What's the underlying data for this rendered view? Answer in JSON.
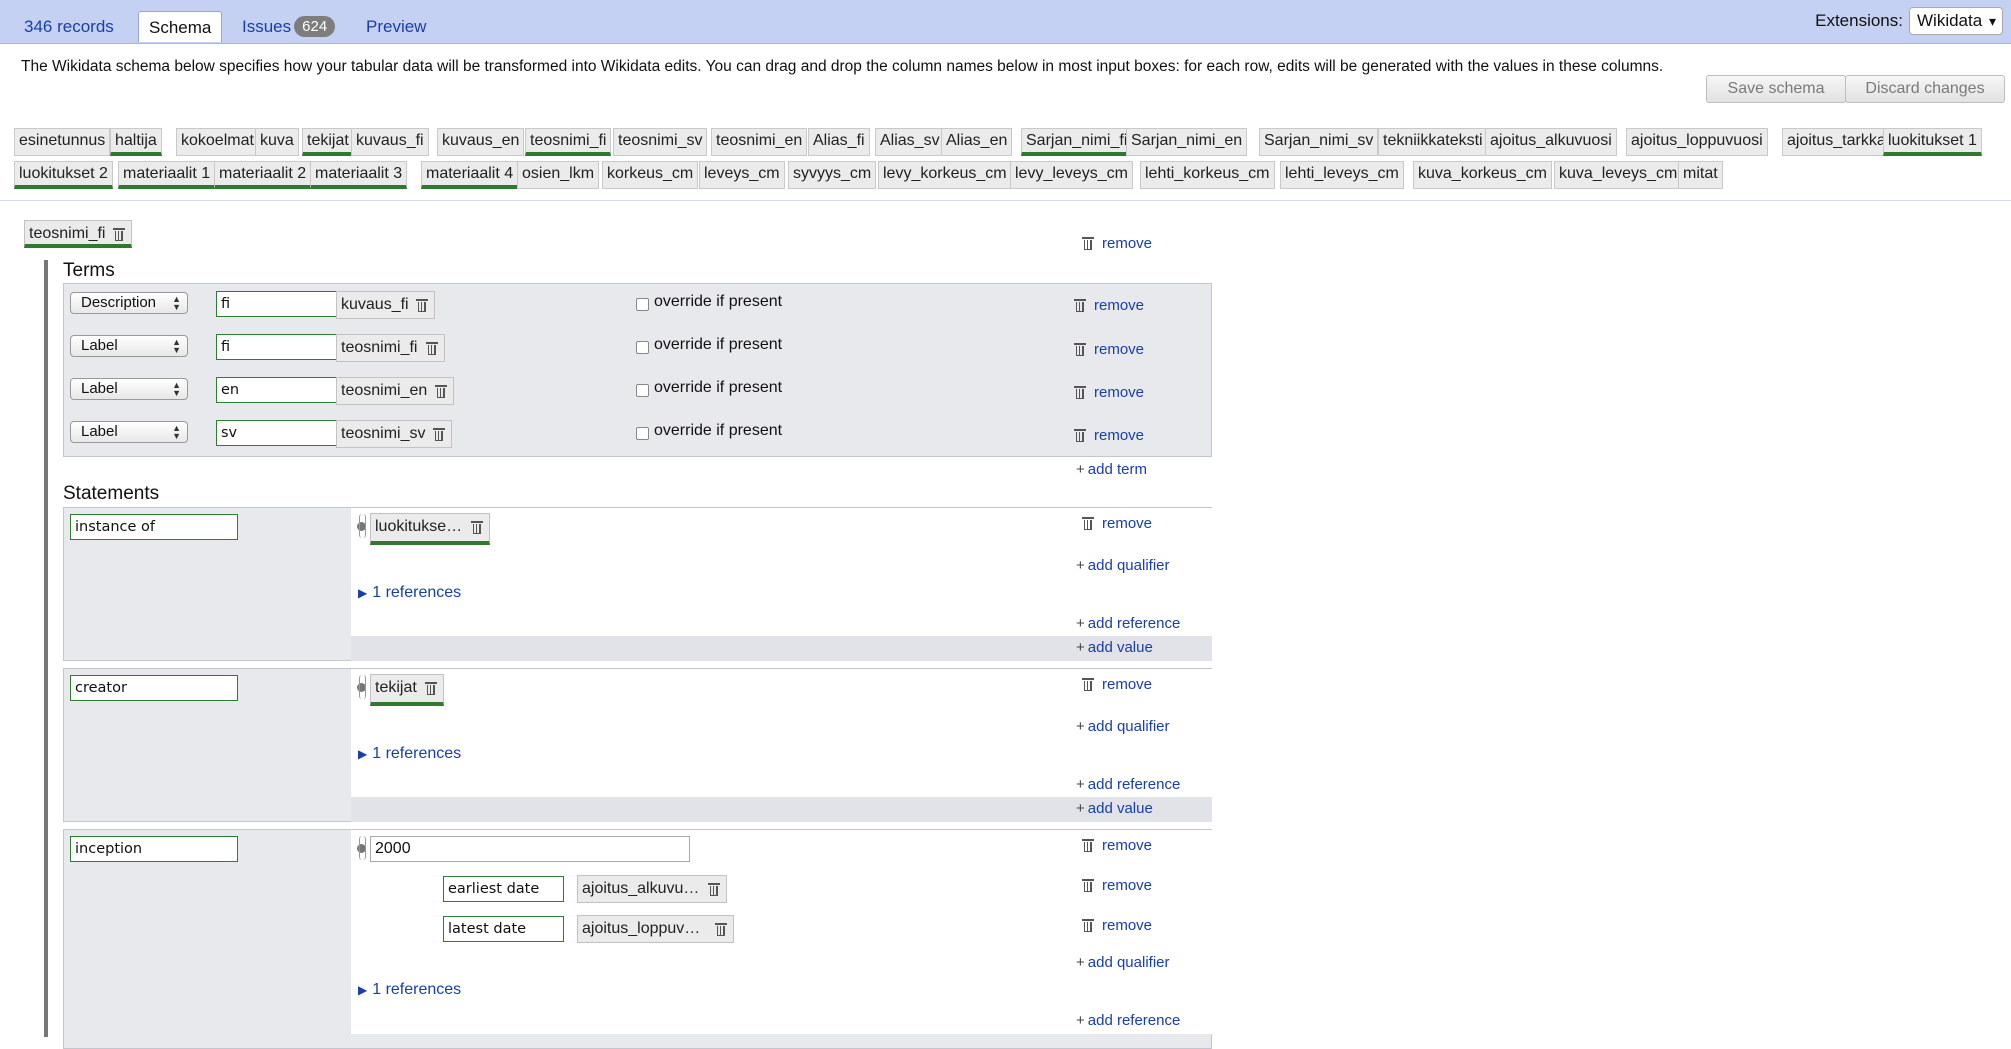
{
  "tabs": {
    "records": "346 records",
    "schema": "Schema",
    "issues": "Issues",
    "issues_count": "624",
    "preview": "Preview"
  },
  "extensions": {
    "label": "Extensions:",
    "selected": "Wikidata",
    "arrow": "▾"
  },
  "description": "The Wikidata schema below specifies how your tabular data will be transformed into Wikidata edits. You can drag and drop the column names below in most input boxes: for each row, edits will be generated with the values in these columns.",
  "buttons": {
    "save": "Save schema",
    "discard": "Discard changes"
  },
  "columns": [
    "esinetunnus",
    "haltija",
    "kokoelmat",
    "kuva",
    "tekijat",
    "kuvaus_fi",
    "kuvaus_en",
    "teosnimi_fi",
    "teosnimi_sv",
    "teosnimi_en",
    "Alias_fi",
    "Alias_sv",
    "Alias_en",
    "Sarjan_nimi_fi",
    "Sarjan_nimi_en",
    "Sarjan_nimi_sv",
    "tekniikkateksti",
    "ajoitus_alkuvuosi",
    "ajoitus_loppuvuosi",
    "ajoitus_tarkka",
    "luokitukset 1",
    "luokitukset 2",
    "materiaalit 1",
    "materiaalit 2",
    "materiaalit 3",
    "materiaalit 4",
    "osien_lkm",
    "korkeus_cm",
    "leveys_cm",
    "syvyys_cm",
    "levy_korkeus_cm",
    "levy_leveys_cm",
    "lehti_korkeus_cm",
    "lehti_leveys_cm",
    "kuva_korkeus_cm",
    "kuva_leveys_cm",
    "mitat"
  ],
  "item": {
    "subject": "teosnimi_fi",
    "remove": "remove",
    "terms_title": "Terms",
    "terms": [
      {
        "type": "Description",
        "lang": "fi",
        "column": "kuvaus_fi",
        "override": "override if present",
        "remove": "remove"
      },
      {
        "type": "Label",
        "lang": "fi",
        "column": "teosnimi_fi",
        "override": "override if present",
        "remove": "remove"
      },
      {
        "type": "Label",
        "lang": "en",
        "column": "teosnimi_en",
        "override": "override if present",
        "remove": "remove"
      },
      {
        "type": "Label",
        "lang": "sv",
        "column": "teosnimi_sv",
        "override": "override if present",
        "remove": "remove"
      }
    ],
    "add_term": "add term",
    "statements_title": "Statements",
    "statements": [
      {
        "property": "instance of",
        "value": "luokitukse…",
        "references": "1 references",
        "remove": "remove",
        "add_qualifier": "add qualifier",
        "add_reference": "add reference",
        "add_value": "add value"
      },
      {
        "property": "creator",
        "value": "tekijat",
        "references": "1 references",
        "remove": "remove",
        "add_qualifier": "add qualifier",
        "add_reference": "add reference",
        "add_value": "add value"
      },
      {
        "property": "inception",
        "value": "2000",
        "references": "1 references",
        "remove": "remove",
        "add_qualifier": "add qualifier",
        "add_reference": "add reference",
        "qualifiers": [
          {
            "property": "earliest date",
            "value": "ajoitus_alkuvu…",
            "remove": "remove"
          },
          {
            "property": "latest date",
            "value": "ajoitus_loppuv…",
            "remove": "remove"
          }
        ]
      }
    ]
  }
}
